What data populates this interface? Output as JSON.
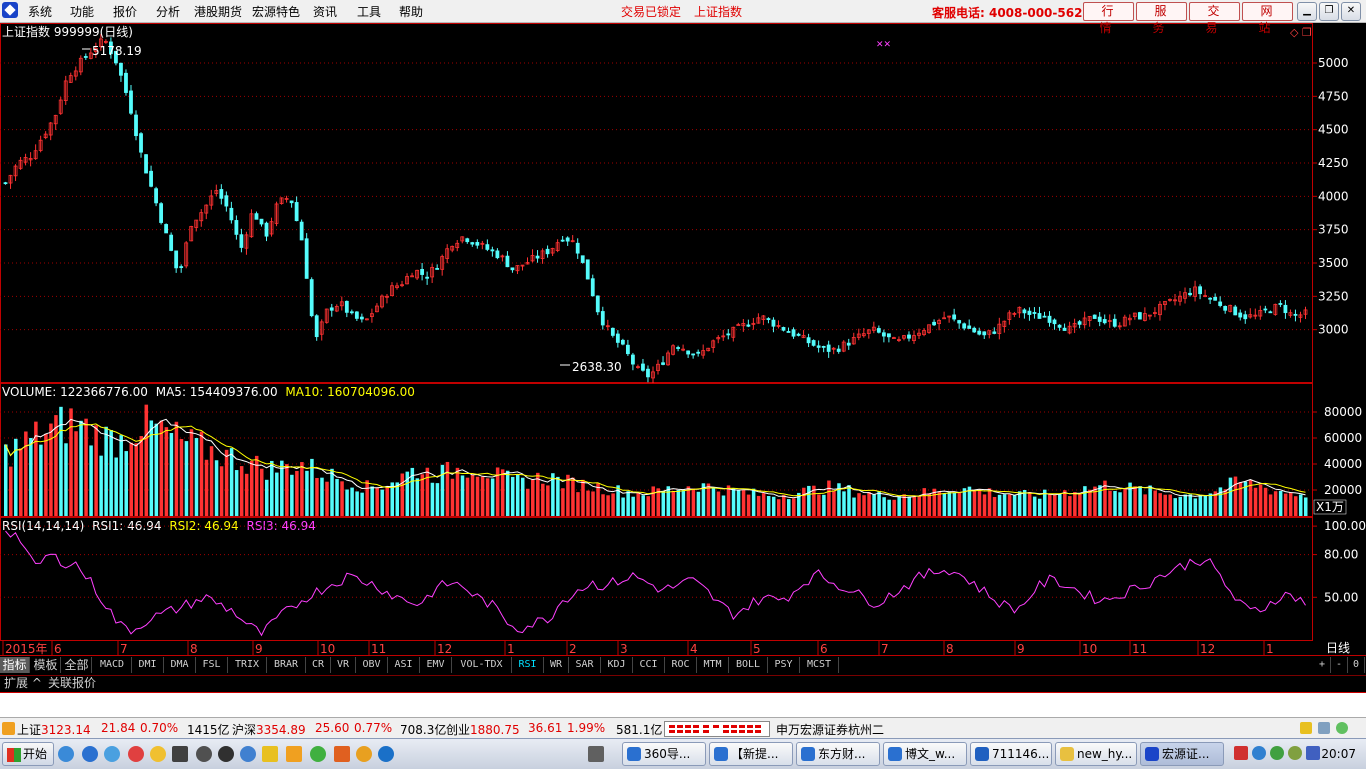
{
  "menu": {
    "items": [
      "系统",
      "功能",
      "报价",
      "分析",
      "港股期货",
      "宏源特色",
      "资讯",
      "工具",
      "帮助"
    ],
    "status_locked": "交易已锁定",
    "status_index": "上证指数",
    "hotline": "客服电话: 4008-000-562",
    "buttons": [
      "行 情",
      "服 务",
      "交 易",
      "网 站"
    ]
  },
  "chart_data": [
    {
      "type": "candlestick",
      "title": "上证指数 999999(日线)",
      "ylim": [
        2600,
        5300
      ],
      "yticks": [
        3000,
        3250,
        3500,
        3750,
        4000,
        4250,
        4500,
        4750,
        5000
      ],
      "annotations": [
        {
          "label": "5178.19"
        },
        {
          "label": "2638.30"
        }
      ],
      "x_labels": [
        "2015年",
        "6",
        "7",
        "8",
        "9",
        "10",
        "11",
        "12",
        "1",
        "2",
        "3",
        "4",
        "5",
        "6",
        "7",
        "8",
        "9",
        "10",
        "11",
        "12",
        "1"
      ],
      "period_label": "日线",
      "path_close": [
        4100,
        4250,
        4300,
        4450,
        4600,
        4900,
        5000,
        5100,
        5178,
        5000,
        4700,
        4300,
        4000,
        3700,
        3400,
        3800,
        3900,
        4050,
        3900,
        3600,
        3900,
        3700,
        3950,
        4000,
        3650,
        2900,
        3150,
        3200,
        3100,
        3050,
        3180,
        3300,
        3350,
        3450,
        3400,
        3500,
        3650,
        3700,
        3650,
        3600,
        3550,
        3450,
        3500,
        3550,
        3600,
        3700,
        3650,
        3400,
        3100,
        2950,
        2850,
        2700,
        2650,
        2750,
        2900,
        2850,
        2800,
        2900,
        2950,
        3000,
        3050,
        3100,
        3050,
        3000,
        2950,
        2900,
        2850,
        2850,
        2900,
        2950,
        3000,
        2950,
        2900,
        2950,
        3000,
        3050,
        3100,
        3050,
        3000,
        2950,
        3000,
        3100,
        3150,
        3100,
        3100,
        3050,
        3000,
        3050,
        3100,
        3050,
        3050,
        3100,
        3100,
        3150,
        3200,
        3250,
        3300,
        3250,
        3200,
        3150,
        3100,
        3100,
        3150,
        3180,
        3100,
        3120
      ]
    },
    {
      "type": "bar",
      "title": "VOLUME: 122366776.00",
      "series_labels": [
        {
          "name": "MA5",
          "value": "154409376.00",
          "color": "#ffffff"
        },
        {
          "name": "MA10",
          "value": "160704096.00",
          "color": "#ffff00"
        }
      ],
      "unit": "X1万",
      "ylim": [
        0,
        90000
      ],
      "yticks": [
        20000,
        40000,
        60000,
        80000
      ],
      "path_values": [
        48000,
        55000,
        62000,
        68000,
        72000,
        66000,
        60000,
        58000,
        70000,
        68000,
        62000,
        56000,
        52000,
        48000,
        44000,
        40000,
        36000,
        38000,
        40000,
        34000,
        30000,
        26000,
        22000,
        24000,
        30000,
        36000,
        32000,
        34000,
        38000,
        36000,
        30000,
        26000,
        28000,
        30000,
        26000,
        24000,
        22000,
        20000,
        18000,
        18000,
        20000,
        22000,
        24000,
        22000,
        20000,
        18000,
        16000,
        16000,
        18000,
        20000,
        22000,
        20000,
        18000,
        16000,
        16000,
        17000,
        18000,
        20000,
        22000,
        20000,
        18000,
        17000,
        16000,
        16000,
        18000,
        20000,
        22000,
        24000,
        22000,
        20000,
        18000,
        17000,
        16000,
        18000,
        22000,
        26000,
        24000,
        20000,
        18000,
        16000
      ]
    },
    {
      "type": "line",
      "title": "RSI(14,14,14)",
      "series_labels": [
        {
          "name": "RSI1",
          "value": "46.94",
          "color": "#ffffff"
        },
        {
          "name": "RSI2",
          "value": "46.94",
          "color": "#ffff00"
        },
        {
          "name": "RSI3",
          "value": "46.94",
          "color": "#ff40ff"
        }
      ],
      "ylim": [
        20,
        105
      ],
      "yticks": [
        50.0,
        80.0,
        100.0
      ],
      "ytick_labels": [
        "50.00",
        "80.00",
        "100.00"
      ],
      "values": [
        98,
        92,
        70,
        80,
        75,
        73,
        60,
        45,
        30,
        27,
        35,
        38,
        42,
        46,
        50,
        45,
        40,
        30,
        24,
        35,
        42,
        50,
        55,
        60,
        65,
        62,
        58,
        52,
        48,
        45,
        55,
        60,
        58,
        50,
        45,
        34,
        28,
        32,
        35,
        48,
        55,
        60,
        58,
        62,
        65,
        60,
        55,
        58,
        62,
        55,
        45,
        38,
        44,
        50,
        48,
        52,
        62,
        66,
        60,
        56,
        50,
        46,
        52,
        58,
        64,
        68,
        70,
        65,
        58,
        50,
        44,
        42,
        55,
        62,
        60,
        55,
        50,
        48,
        52,
        56,
        60,
        66,
        70,
        75,
        77,
        65,
        50,
        40,
        42,
        50,
        52,
        46
      ]
    }
  ],
  "indicator_tabs": {
    "categories": [
      "指标",
      "模板",
      "全部"
    ],
    "items": [
      "MACD",
      "DMI",
      "DMA",
      "FSL",
      "TRIX",
      "BRAR",
      "CR",
      "VR",
      "OBV",
      "ASI",
      "EMV",
      "VOL-TDX",
      "RSI",
      "WR",
      "SAR",
      "KDJ",
      "CCI",
      "ROC",
      "MTM",
      "BOLL",
      "PSY",
      "MCST"
    ],
    "selected": "RSI",
    "right_controls": [
      "+",
      "-",
      "0"
    ]
  },
  "ext_tabs": [
    "扩展 ^",
    "关联报价"
  ],
  "statusbar": {
    "sh": {
      "name": "上证",
      "value": "3123.14",
      "change": "21.84",
      "pct": "0.70%",
      "amount": "1415亿"
    },
    "hs": {
      "name": "沪深",
      "value": "3354.89",
      "change": "25.60",
      "pct": "0.77%",
      "amount": "708.3亿"
    },
    "cy": {
      "name": "创业",
      "value": "1880.75",
      "change": "36.61",
      "pct": "1.99%",
      "amount": "581.1亿"
    },
    "broker": "申万宏源证券杭州二"
  },
  "taskbar": {
    "start": "开始",
    "tasks": [
      "360导...",
      "【新提...",
      "东方财...",
      "博文_w...",
      "711146...",
      "new_hy...",
      "宏源证..."
    ],
    "active_index": 6,
    "clock": "20:07"
  },
  "colors": {
    "up": "#ff3232",
    "down": "#54fcfc",
    "ma5": "#ffffff",
    "ma10": "#ffff00",
    "rsi": "#ff40ff",
    "grid": "#a00000"
  }
}
